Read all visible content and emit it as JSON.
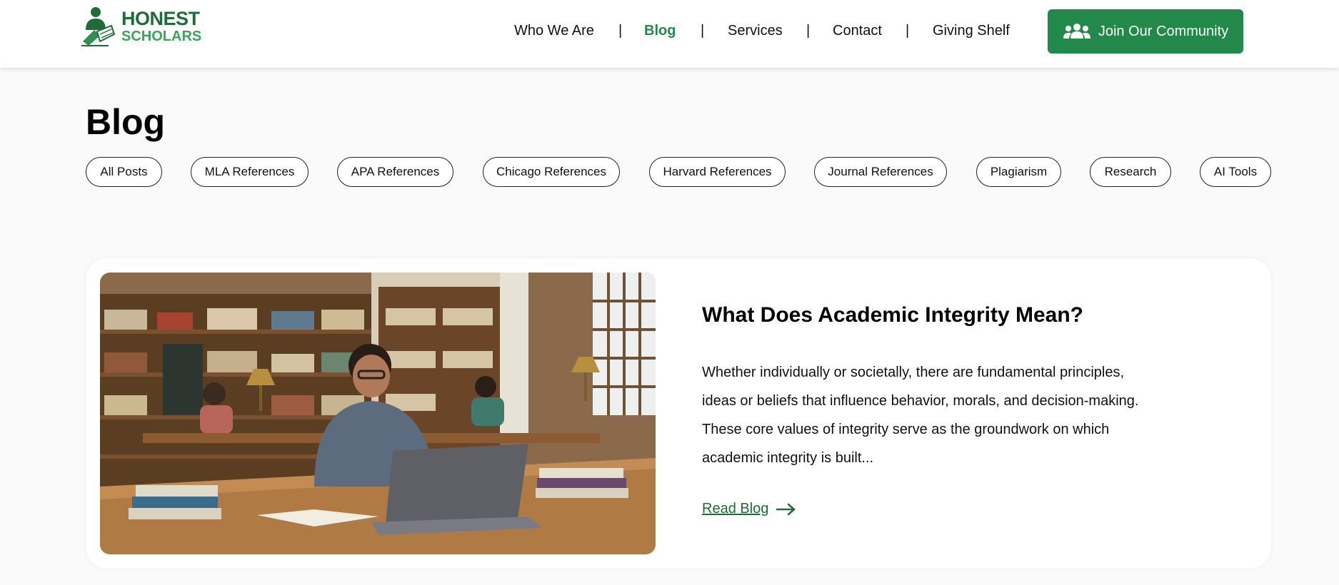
{
  "brand": {
    "line1": "HONEST",
    "line2": "SCHOLARS"
  },
  "nav": {
    "items": [
      {
        "label": "Who We Are"
      },
      {
        "label": "Blog",
        "active": true
      },
      {
        "label": "Services"
      },
      {
        "label": "Contact"
      },
      {
        "label": "Giving Shelf"
      }
    ],
    "separator": "|"
  },
  "cta": {
    "label": "Join Our Community",
    "icon": "community-icon"
  },
  "page": {
    "title": "Blog"
  },
  "filters": [
    "All Posts",
    "MLA References",
    "APA References",
    "Chicago References",
    "Harvard References",
    "Journal References",
    "Plagiarism",
    "Research",
    "AI Tools"
  ],
  "featured": {
    "title": "What Does Academic Integrity Mean?",
    "excerpt": "Whether individually or societally, there are fundamental principles, ideas or beliefs that influence behavior, morals, and decision-making. These core values of integrity serve as the groundwork on which academic integrity is built...",
    "link_label": "Read Blog",
    "link_icon": "arrow-right-icon",
    "image": "library-student-laptop-photo"
  },
  "colors": {
    "brand_green": "#23894a",
    "brand_dark_green": "#1f6b3a",
    "brand_light_green": "#3aa55a"
  }
}
